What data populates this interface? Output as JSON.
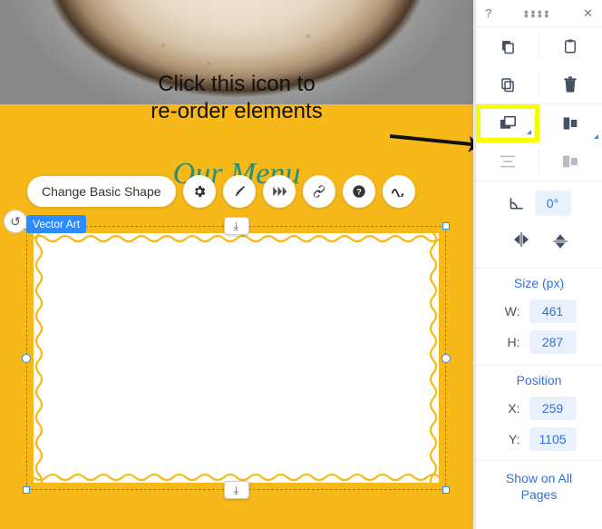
{
  "annotation": {
    "line1": "Click this icon to",
    "line2": "re-order elements"
  },
  "canvas": {
    "heading": "Our Menu",
    "toolbar": {
      "change_shape": "Change Basic Shape"
    },
    "selection_badge": "Vector Art"
  },
  "panel": {
    "header": {
      "help": "?",
      "close": "✕"
    },
    "rotation_value": "0°",
    "size": {
      "title": "Size (px)",
      "w_label": "W:",
      "w_value": "461",
      "h_label": "H:",
      "h_value": "287"
    },
    "position": {
      "title": "Position",
      "x_label": "X:",
      "x_value": "259",
      "y_label": "Y:",
      "y_value": "1105"
    },
    "show_all": "Show on All Pages"
  }
}
